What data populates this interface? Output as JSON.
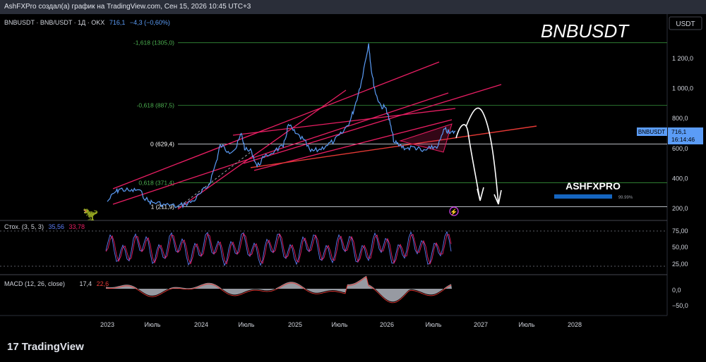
{
  "header": {
    "caption": "AshFXPro создал(а) график на TradingView.com, Сен 15, 2026 10:45 UTC+3"
  },
  "legend": {
    "symbol": "BNBUSDT · BNB/USDT · 1Д · OKX",
    "last": "716,1",
    "change": "−4,3 (−0,60%)"
  },
  "watermark_title": "BNBUSDT",
  "brand": {
    "name": "ASHFXPRO",
    "progress_label": "99.99%",
    "progress": 0.9999
  },
  "footer": {
    "logo_mark": "17",
    "logo_text": "TradingView"
  },
  "price_label": {
    "symbol": "BNBUSDT",
    "value": "716,1",
    "countdown": "16:14:46"
  },
  "colors": {
    "price_line": "#5b9cf6",
    "trend_lines": "#e91e63",
    "red_line": "#e53935",
    "stoch_k": "#5b7cf6",
    "stoch_d": "#e91e63",
    "fib_green": "#4caf50",
    "macd_area": "#b2b5be"
  },
  "chart_data": {
    "type": "line",
    "title": "BNBUSDT",
    "currency": "USDT",
    "y_axis_ticks": [
      "1 200,0",
      "1 000,0",
      "800,0",
      "600,0",
      "400,0",
      "200,0"
    ],
    "ylim": [
      180,
      1380
    ],
    "x_ticks": [
      "2023",
      "Июль",
      "2024",
      "Июль",
      "2025",
      "Июль",
      "2026",
      "Июль",
      "2027",
      "Июль",
      "2028"
    ],
    "fib_levels": [
      {
        "label": "-1,618 (1305,0)",
        "value": 1305.0
      },
      {
        "label": "-0,618 (887,5)",
        "value": 887.5
      },
      {
        "label": "0 (629,4)",
        "value": 629.4
      },
      {
        "label": "0,618 (371,4)",
        "value": 371.4
      },
      {
        "label": "1 (211,9)",
        "value": 211.9
      }
    ],
    "series": [
      {
        "name": "BNBUSDT",
        "points": [
          [
            "2023-01-01",
            246
          ],
          [
            "2023-02-01",
            310
          ],
          [
            "2023-02-20",
            330
          ],
          [
            "2023-04-01",
            316
          ],
          [
            "2023-05-01",
            325
          ],
          [
            "2023-06-10",
            245
          ],
          [
            "2023-07-01",
            240
          ],
          [
            "2023-08-15",
            225
          ],
          [
            "2023-10-01",
            214
          ],
          [
            "2023-11-01",
            230
          ],
          [
            "2023-12-01",
            250
          ],
          [
            "2024-01-01",
            305
          ],
          [
            "2024-02-01",
            360
          ],
          [
            "2024-03-01",
            520
          ],
          [
            "2024-03-15",
            625
          ],
          [
            "2024-04-15",
            580
          ],
          [
            "2024-05-15",
            600
          ],
          [
            "2024-06-05",
            700
          ],
          [
            "2024-06-20",
            590
          ],
          [
            "2024-07-15",
            580
          ],
          [
            "2024-08-05",
            480
          ],
          [
            "2024-09-01",
            540
          ],
          [
            "2024-10-15",
            590
          ],
          [
            "2024-11-15",
            610
          ],
          [
            "2024-12-05",
            760
          ],
          [
            "2025-01-01",
            700
          ],
          [
            "2025-02-01",
            660
          ],
          [
            "2025-03-01",
            580
          ],
          [
            "2025-04-01",
            590
          ],
          [
            "2025-05-01",
            620
          ],
          [
            "2025-06-01",
            650
          ],
          [
            "2025-07-01",
            700
          ],
          [
            "2025-08-01",
            780
          ],
          [
            "2025-08-20",
            880
          ],
          [
            "2025-09-15",
            1050
          ],
          [
            "2025-10-13",
            1300
          ],
          [
            "2025-10-25",
            1100
          ],
          [
            "2025-11-10",
            960
          ],
          [
            "2025-12-01",
            880
          ],
          [
            "2025-12-20",
            870
          ],
          [
            "2026-01-05",
            760
          ],
          [
            "2026-01-20",
            640
          ],
          [
            "2026-02-10",
            620
          ],
          [
            "2026-03-10",
            600
          ],
          [
            "2026-04-10",
            610
          ],
          [
            "2026-05-10",
            580
          ],
          [
            "2026-06-10",
            600
          ],
          [
            "2026-07-10",
            620
          ],
          [
            "2026-08-05",
            730
          ],
          [
            "2026-08-25",
            700
          ],
          [
            "2026-09-15",
            716
          ]
        ]
      }
    ],
    "last_value": 716.1,
    "stochastic": {
      "label": "Стох. (3, 5, 3)",
      "k": "35,56",
      "d": "33,78",
      "ticks": [
        "75,00",
        "50,00",
        "25,00"
      ]
    },
    "macd": {
      "label": "MACD (12, 26, close)",
      "macd": "17,4",
      "signal": "22,6",
      "ticks": [
        "0,0",
        "−50,0"
      ]
    }
  }
}
